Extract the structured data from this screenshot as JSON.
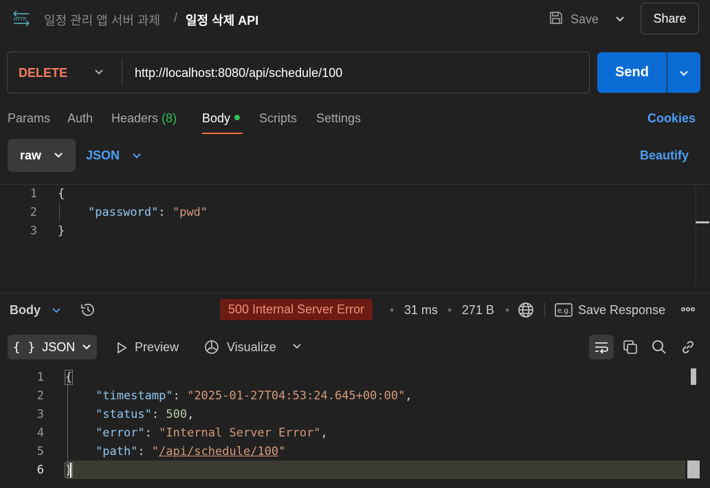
{
  "header": {
    "collection_path": "일정 관리 앱 서버 과제",
    "separator": "/",
    "request_name": "일정 삭제 API",
    "save_label": "Save",
    "share_label": "Share",
    "http_icon": "http-icon"
  },
  "request": {
    "method": "DELETE",
    "url": "http://localhost:8080/api/schedule/100",
    "send_label": "Send"
  },
  "tabs": {
    "params": "Params",
    "auth": "Auth",
    "headers": "Headers",
    "headers_count": "(8)",
    "body": "Body",
    "scripts": "Scripts",
    "settings": "Settings",
    "active": "Body",
    "cookies": "Cookies"
  },
  "body_options": {
    "mode": "raw",
    "language": "JSON",
    "beautify": "Beautify"
  },
  "request_body": {
    "line_numbers": [
      "1",
      "2",
      "3"
    ],
    "open_brace": "{",
    "key": "\"password\"",
    "colon": ": ",
    "value": "\"pwd\"",
    "close_brace": "}"
  },
  "response": {
    "section_label": "Body",
    "status": "500 Internal Server Error",
    "time": "31 ms",
    "size": "271 B",
    "bullet": "•",
    "save_response": "Save Response",
    "more": "ooo",
    "format": "JSON",
    "format_icon": "{ }",
    "preview": "Preview",
    "visualize": "Visualize",
    "status_color": "#6b1d14"
  },
  "response_body": {
    "line_numbers": [
      "1",
      "2",
      "3",
      "4",
      "5",
      "6"
    ],
    "open_brace": "{",
    "close_brace": "}",
    "timestamp_key": "\"timestamp\"",
    "timestamp_value": "\"2025-01-27T04:53:24.645+00:00\"",
    "status_key": "\"status\"",
    "status_value": "500",
    "error_key": "\"error\"",
    "error_value": "\"Internal Server Error\"",
    "path_key": "\"path\"",
    "path_quote": "\"",
    "path_value": "/api/schedule/100",
    "colon": ": ",
    "comma": ","
  },
  "colors": {
    "accent_blue": "#0a6bd4",
    "link_blue": "#4c9ef5",
    "method_delete": "#f37b63",
    "tab_underline": "#f26b3a",
    "success_green": "#32c25c"
  }
}
